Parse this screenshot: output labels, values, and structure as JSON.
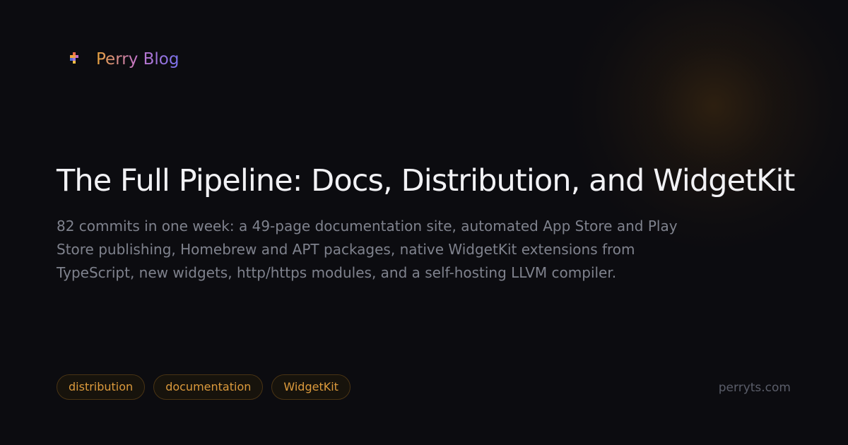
{
  "brand": {
    "name": "Perry Blog",
    "logo_icon": "pixel-cross-logo-icon",
    "colors": [
      "#e8a33c",
      "#c777c8",
      "#7a72ee"
    ]
  },
  "post": {
    "title": "The Full Pipeline: Docs, Distribution, and WidgetKit",
    "summary": "82 commits in one week: a 49-page documentation site, automated App Store and Play Store publishing, Homebrew and APT packages, native WidgetKit extensions from TypeScript, new widgets, http/https modules, and a self-hosting LLVM compiler."
  },
  "tags": [
    "distribution",
    "documentation",
    "WidgetKit"
  ],
  "footer": {
    "site": "perryts.com"
  },
  "colors": {
    "background": "#0c0c10",
    "accent": "#dc9a3c",
    "title": "#f2f2f5",
    "muted": "#7f828d"
  }
}
